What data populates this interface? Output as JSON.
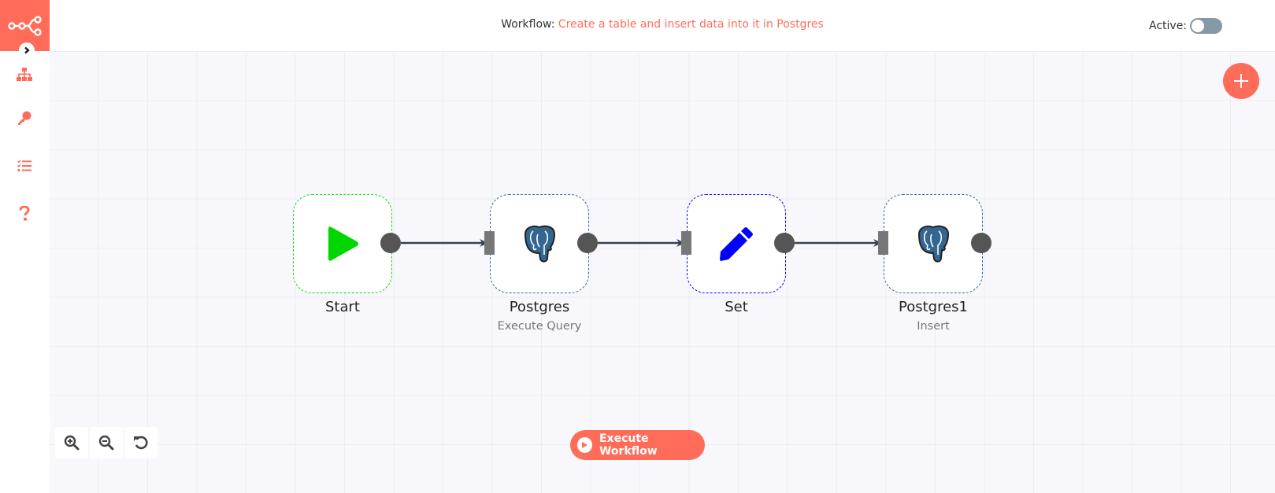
{
  "app": {
    "logo_icon": "n8n-logo-icon"
  },
  "sidebar": {
    "expand_icon": "chevron-right-icon",
    "items": [
      {
        "id": "workflows",
        "icon": "network-icon"
      },
      {
        "id": "credentials",
        "icon": "key-icon"
      },
      {
        "id": "executions",
        "icon": "tasks-list-icon"
      },
      {
        "id": "help",
        "icon": "question-icon"
      }
    ]
  },
  "header": {
    "workflow_label": "Workflow:",
    "workflow_name": "Create a table and insert data into it in Postgres",
    "active_label": "Active:",
    "active": false
  },
  "canvas": {
    "add_node_icon": "plus-icon",
    "nodes": [
      {
        "name": "Start",
        "subtitle": "",
        "icon": "play-icon",
        "border_color": "#00e000"
      },
      {
        "name": "Postgres",
        "subtitle": "Execute Query",
        "icon": "postgres-elephant-icon",
        "border_color": "#336791"
      },
      {
        "name": "Set",
        "subtitle": "",
        "icon": "pencil-icon",
        "border_color": "#0000ff"
      },
      {
        "name": "Postgres1",
        "subtitle": "Insert",
        "icon": "postgres-elephant-icon",
        "border_color": "#336791"
      }
    ],
    "connections": [
      {
        "from": "Start",
        "to": "Postgres"
      },
      {
        "from": "Postgres",
        "to": "Set"
      },
      {
        "from": "Set",
        "to": "Postgres1"
      }
    ],
    "zoom_controls": [
      {
        "id": "zoom-in",
        "icon": "zoom-in-icon"
      },
      {
        "id": "zoom-out",
        "icon": "zoom-out-icon"
      },
      {
        "id": "reset",
        "icon": "reset-zoom-icon"
      }
    ],
    "execute_label": "Execute Workflow"
  },
  "colors": {
    "brand": "#ff6d5a",
    "canvas_bg": "#f8f8fc",
    "toggle_off": "#8899a6",
    "connection": "#374151"
  }
}
